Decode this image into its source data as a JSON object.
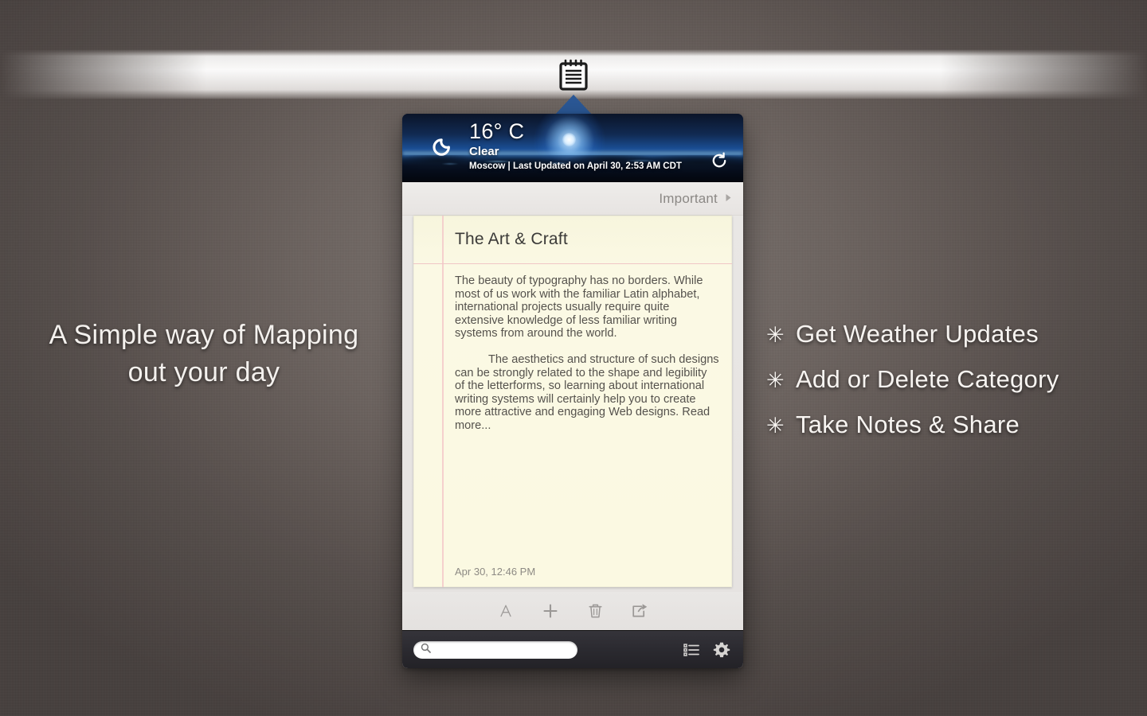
{
  "menubar": {
    "icon": "notepad-icon"
  },
  "weather": {
    "temperature": "16° C",
    "condition": "Clear",
    "meta": "Moscow | Last Updated on April 30, 2:53 AM CDT",
    "location": "Moscow",
    "last_updated": "Last Updated on April 30, 2:53 AM CDT",
    "condition_icon": "moon-icon",
    "refresh_icon": "refresh-icon"
  },
  "category": {
    "label": "Important",
    "chevron_icon": "chevron-right-icon"
  },
  "note": {
    "title": "The Art & Craft",
    "paragraphs": [
      "The beauty of typography has no borders. While most of us work with the familiar Latin alphabet, international projects usually require quite extensive knowledge of less familiar writing systems from around the world.",
      "The aesthetics and structure of such designs can be strongly related to the shape and legibility of the letterforms, so learning about international writing systems will certainly help you to create more attractive and engaging Web designs. Read more..."
    ],
    "timestamp": "Apr 30, 12:46 PM"
  },
  "note_toolbar": {
    "buttons": [
      {
        "name": "font-button",
        "icon": "font-a-icon",
        "glyph": "A"
      },
      {
        "name": "add-note-button",
        "icon": "plus-icon",
        "glyph": "+"
      },
      {
        "name": "delete-note-button",
        "icon": "trash-icon",
        "glyph": ""
      },
      {
        "name": "share-note-button",
        "icon": "share-icon",
        "glyph": ""
      }
    ]
  },
  "bottom_bar": {
    "search_placeholder": "",
    "search_value": "",
    "search_icon": "search-icon",
    "list_icon": "list-view-icon",
    "settings_icon": "gear-icon"
  },
  "marketing": {
    "tagline_line1": "A Simple way of Mapping",
    "tagline_line2": "out your day",
    "features": [
      {
        "star": "✳",
        "label": "Get Weather Updates"
      },
      {
        "star": "✳",
        "label": "Add or Delete Category"
      },
      {
        "star": "✳",
        "label": "Take Notes & Share"
      }
    ]
  },
  "colors": {
    "panel_bg": "#e9e7e5",
    "paper_bg": "#fbf9e2",
    "margin_rule": "#f3c9c9",
    "bottom_bar": "#2b2a30",
    "arrow_blue": "#2b5896",
    "desktop": "#6b625e"
  }
}
